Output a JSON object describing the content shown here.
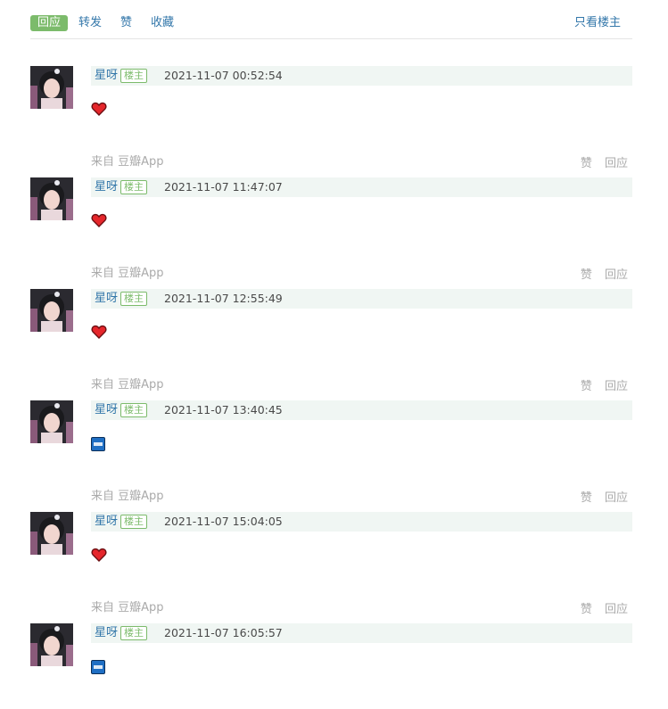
{
  "topbar": {
    "reply_label": "回应",
    "forward_label": "转发",
    "like_label": "赞",
    "collect_label": "收藏",
    "only_op_label": "只看楼主"
  },
  "posts": [
    {
      "author": "星呀",
      "badge": "楼主",
      "time": "2021-11-07 00:52:54",
      "content_icon": "heart-icon",
      "source": "来自 豆瓣App",
      "like_label": "赞",
      "reply_label": "回应"
    },
    {
      "author": "星呀",
      "badge": "楼主",
      "time": "2021-11-07 11:47:07",
      "content_icon": "heart-icon",
      "source": "来自 豆瓣App",
      "like_label": "赞",
      "reply_label": "回应"
    },
    {
      "author": "星呀",
      "badge": "楼主",
      "time": "2021-11-07 12:55:49",
      "content_icon": "heart-icon",
      "source": "来自 豆瓣App",
      "like_label": "赞",
      "reply_label": "回应"
    },
    {
      "author": "星呀",
      "badge": "楼主",
      "time": "2021-11-07 13:40:45",
      "content_icon": "up-icon",
      "source": "来自 豆瓣App",
      "like_label": "赞",
      "reply_label": "回应"
    },
    {
      "author": "星呀",
      "badge": "楼主",
      "time": "2021-11-07 15:04:05",
      "content_icon": "heart-icon",
      "source": "来自 豆瓣App",
      "like_label": "赞",
      "reply_label": "回应"
    },
    {
      "author": "星呀",
      "badge": "楼主",
      "time": "2021-11-07 16:05:57",
      "content_icon": "up-icon"
    }
  ],
  "colors": {
    "link": "#3377aa",
    "accent_green": "#7cbb6b",
    "meta_bg": "#f0f6f3",
    "muted": "#aaaaaa",
    "heart": "#e5262b",
    "up_blue": "#1f6fc4"
  }
}
